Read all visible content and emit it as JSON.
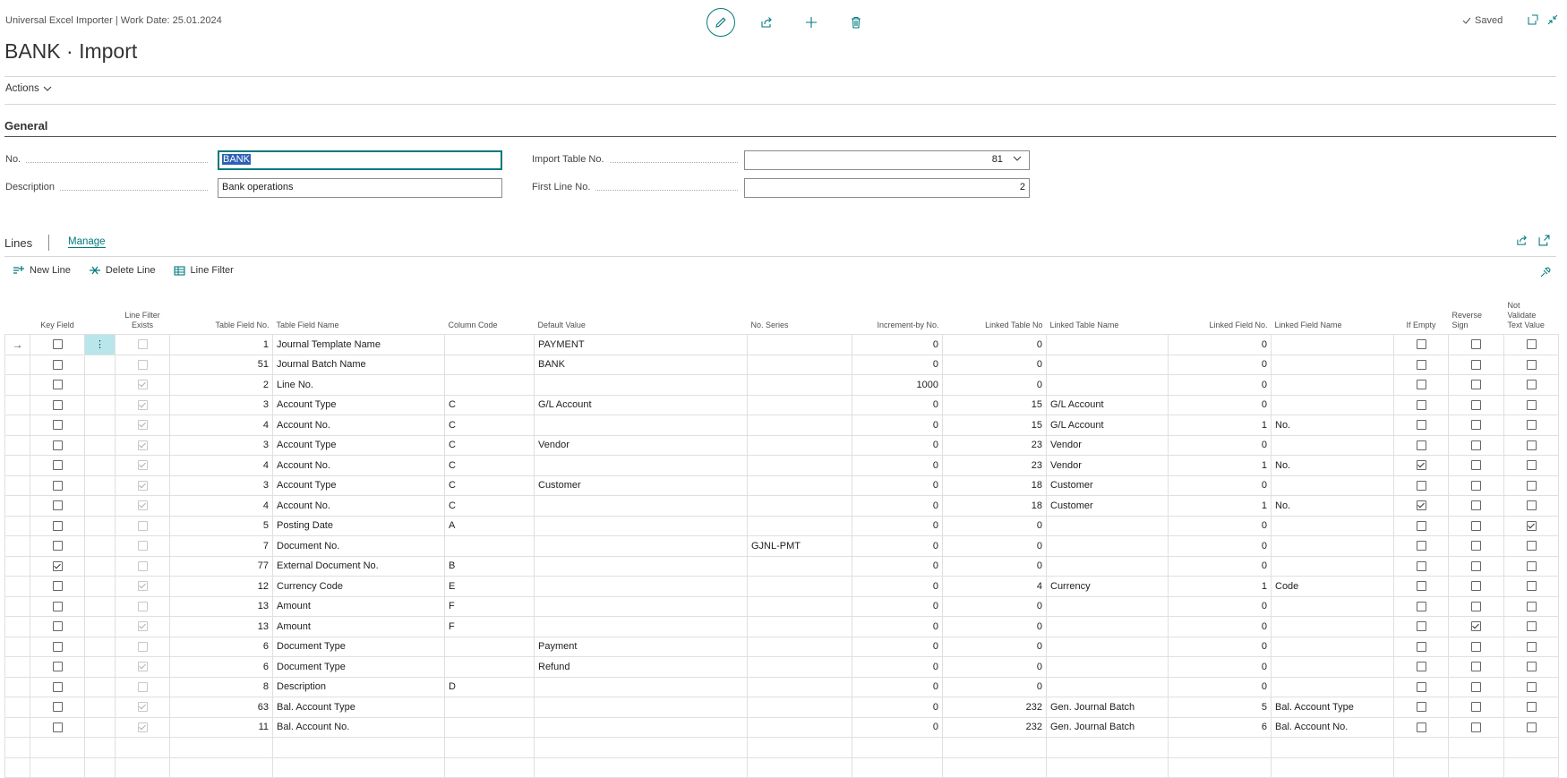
{
  "header": {
    "breadcrumb": "Universal Excel Importer | Work Date: 25.01.2024",
    "title": "BANK · Import",
    "saved_label": "Saved"
  },
  "actions_label": "Actions",
  "general": {
    "section_title": "General",
    "no_label": "No.",
    "no_value": "BANK",
    "description_label": "Description",
    "description_value": "Bank operations",
    "import_table_label": "Import Table No.",
    "import_table_value": "81",
    "first_line_label": "First Line No.",
    "first_line_value": "2"
  },
  "lines": {
    "title": "Lines",
    "manage_tab": "Manage",
    "toolbar": {
      "new_line": "New Line",
      "delete_line": "Delete Line",
      "line_filter": "Line Filter"
    },
    "columns": {
      "key_field": "Key Field",
      "line_filter_exists_1": "Line Filter",
      "line_filter_exists_2": "Exists",
      "table_field_no": "Table Field No.",
      "table_field_name": "Table Field Name",
      "column_code": "Column Code",
      "default_value": "Default Value",
      "no_series": "No. Series",
      "increment_by": "Increment-by No.",
      "linked_table_no": "Linked Table No",
      "linked_table_name": "Linked Table Name",
      "linked_field_no": "Linked Field No.",
      "linked_field_name": "Linked Field Name",
      "if_empty": "If Empty",
      "reverse_sign_1": "Reverse",
      "reverse_sign_2": "Sign",
      "not_validate_1": "Not",
      "not_validate_2": "Validate",
      "not_validate_3": "Text Value"
    },
    "rows": [
      {
        "key": false,
        "lfe": false,
        "no": "1",
        "name": "Journal Template Name",
        "col": "",
        "def": "PAYMENT",
        "series": "",
        "inc": "0",
        "ltno": "0",
        "ltname": "",
        "lfno": "0",
        "lfname": "",
        "empty": false,
        "rev": false,
        "nv": false
      },
      {
        "key": false,
        "lfe": false,
        "no": "51",
        "name": "Journal Batch Name",
        "col": "",
        "def": "BANK",
        "series": "",
        "inc": "0",
        "ltno": "0",
        "ltname": "",
        "lfno": "0",
        "lfname": "",
        "empty": false,
        "rev": false,
        "nv": false
      },
      {
        "key": false,
        "lfe": true,
        "no": "2",
        "name": "Line No.",
        "col": "",
        "def": "",
        "series": "",
        "inc": "1000",
        "ltno": "0",
        "ltname": "",
        "lfno": "0",
        "lfname": "",
        "empty": false,
        "rev": false,
        "nv": false
      },
      {
        "key": false,
        "lfe": true,
        "no": "3",
        "name": "Account Type",
        "col": "C",
        "def": "G/L Account",
        "series": "",
        "inc": "0",
        "ltno": "15",
        "ltname": "G/L Account",
        "lfno": "0",
        "lfname": "",
        "empty": false,
        "rev": false,
        "nv": false
      },
      {
        "key": false,
        "lfe": true,
        "no": "4",
        "name": "Account No.",
        "col": "C",
        "def": "",
        "series": "",
        "inc": "0",
        "ltno": "15",
        "ltname": "G/L Account",
        "lfno": "1",
        "lfname": "No.",
        "empty": false,
        "rev": false,
        "nv": false
      },
      {
        "key": false,
        "lfe": true,
        "no": "3",
        "name": "Account Type",
        "col": "C",
        "def": "Vendor",
        "series": "",
        "inc": "0",
        "ltno": "23",
        "ltname": "Vendor",
        "lfno": "0",
        "lfname": "",
        "empty": false,
        "rev": false,
        "nv": false
      },
      {
        "key": false,
        "lfe": true,
        "no": "4",
        "name": "Account No.",
        "col": "C",
        "def": "",
        "series": "",
        "inc": "0",
        "ltno": "23",
        "ltname": "Vendor",
        "lfno": "1",
        "lfname": "No.",
        "empty": true,
        "rev": false,
        "nv": false
      },
      {
        "key": false,
        "lfe": true,
        "no": "3",
        "name": "Account Type",
        "col": "C",
        "def": "Customer",
        "series": "",
        "inc": "0",
        "ltno": "18",
        "ltname": "Customer",
        "lfno": "0",
        "lfname": "",
        "empty": false,
        "rev": false,
        "nv": false
      },
      {
        "key": false,
        "lfe": true,
        "no": "4",
        "name": "Account No.",
        "col": "C",
        "def": "",
        "series": "",
        "inc": "0",
        "ltno": "18",
        "ltname": "Customer",
        "lfno": "1",
        "lfname": "No.",
        "empty": true,
        "rev": false,
        "nv": false
      },
      {
        "key": false,
        "lfe": false,
        "no": "5",
        "name": "Posting Date",
        "col": "A",
        "def": "",
        "series": "",
        "inc": "0",
        "ltno": "0",
        "ltname": "",
        "lfno": "0",
        "lfname": "",
        "empty": false,
        "rev": false,
        "nv": true
      },
      {
        "key": false,
        "lfe": false,
        "no": "7",
        "name": "Document No.",
        "col": "",
        "def": "",
        "series": "GJNL-PMT",
        "inc": "0",
        "ltno": "0",
        "ltname": "",
        "lfno": "0",
        "lfname": "",
        "empty": false,
        "rev": false,
        "nv": false
      },
      {
        "key": true,
        "lfe": false,
        "no": "77",
        "name": "External Document No.",
        "col": "B",
        "def": "",
        "series": "",
        "inc": "0",
        "ltno": "0",
        "ltname": "",
        "lfno": "0",
        "lfname": "",
        "empty": false,
        "rev": false,
        "nv": false
      },
      {
        "key": false,
        "lfe": true,
        "no": "12",
        "name": "Currency Code",
        "col": "E",
        "def": "",
        "series": "",
        "inc": "0",
        "ltno": "4",
        "ltname": "Currency",
        "lfno": "1",
        "lfname": "Code",
        "empty": false,
        "rev": false,
        "nv": false
      },
      {
        "key": false,
        "lfe": false,
        "no": "13",
        "name": "Amount",
        "col": "F",
        "def": "",
        "series": "",
        "inc": "0",
        "ltno": "0",
        "ltname": "",
        "lfno": "0",
        "lfname": "",
        "empty": false,
        "rev": false,
        "nv": false
      },
      {
        "key": false,
        "lfe": true,
        "no": "13",
        "name": "Amount",
        "col": "F",
        "def": "",
        "series": "",
        "inc": "0",
        "ltno": "0",
        "ltname": "",
        "lfno": "0",
        "lfname": "",
        "empty": false,
        "rev": true,
        "nv": false
      },
      {
        "key": false,
        "lfe": false,
        "no": "6",
        "name": "Document Type",
        "col": "",
        "def": "Payment",
        "series": "",
        "inc": "0",
        "ltno": "0",
        "ltname": "",
        "lfno": "0",
        "lfname": "",
        "empty": false,
        "rev": false,
        "nv": false
      },
      {
        "key": false,
        "lfe": true,
        "no": "6",
        "name": "Document Type",
        "col": "",
        "def": "Refund",
        "series": "",
        "inc": "0",
        "ltno": "0",
        "ltname": "",
        "lfno": "0",
        "lfname": "",
        "empty": false,
        "rev": false,
        "nv": false
      },
      {
        "key": false,
        "lfe": false,
        "no": "8",
        "name": "Description",
        "col": "D",
        "def": "",
        "series": "",
        "inc": "0",
        "ltno": "0",
        "ltname": "",
        "lfno": "0",
        "lfname": "",
        "empty": false,
        "rev": false,
        "nv": false
      },
      {
        "key": false,
        "lfe": true,
        "no": "63",
        "name": "Bal. Account Type",
        "col": "",
        "def": "",
        "series": "",
        "inc": "0",
        "ltno": "232",
        "ltname": "Gen. Journal Batch",
        "lfno": "5",
        "lfname": "Bal. Account Type",
        "empty": false,
        "rev": false,
        "nv": false
      },
      {
        "key": false,
        "lfe": true,
        "no": "11",
        "name": "Bal. Account No.",
        "col": "",
        "def": "",
        "series": "",
        "inc": "0",
        "ltno": "232",
        "ltname": "Gen. Journal Batch",
        "lfno": "6",
        "lfname": "Bal. Account No.",
        "empty": false,
        "rev": false,
        "nv": false
      }
    ]
  }
}
